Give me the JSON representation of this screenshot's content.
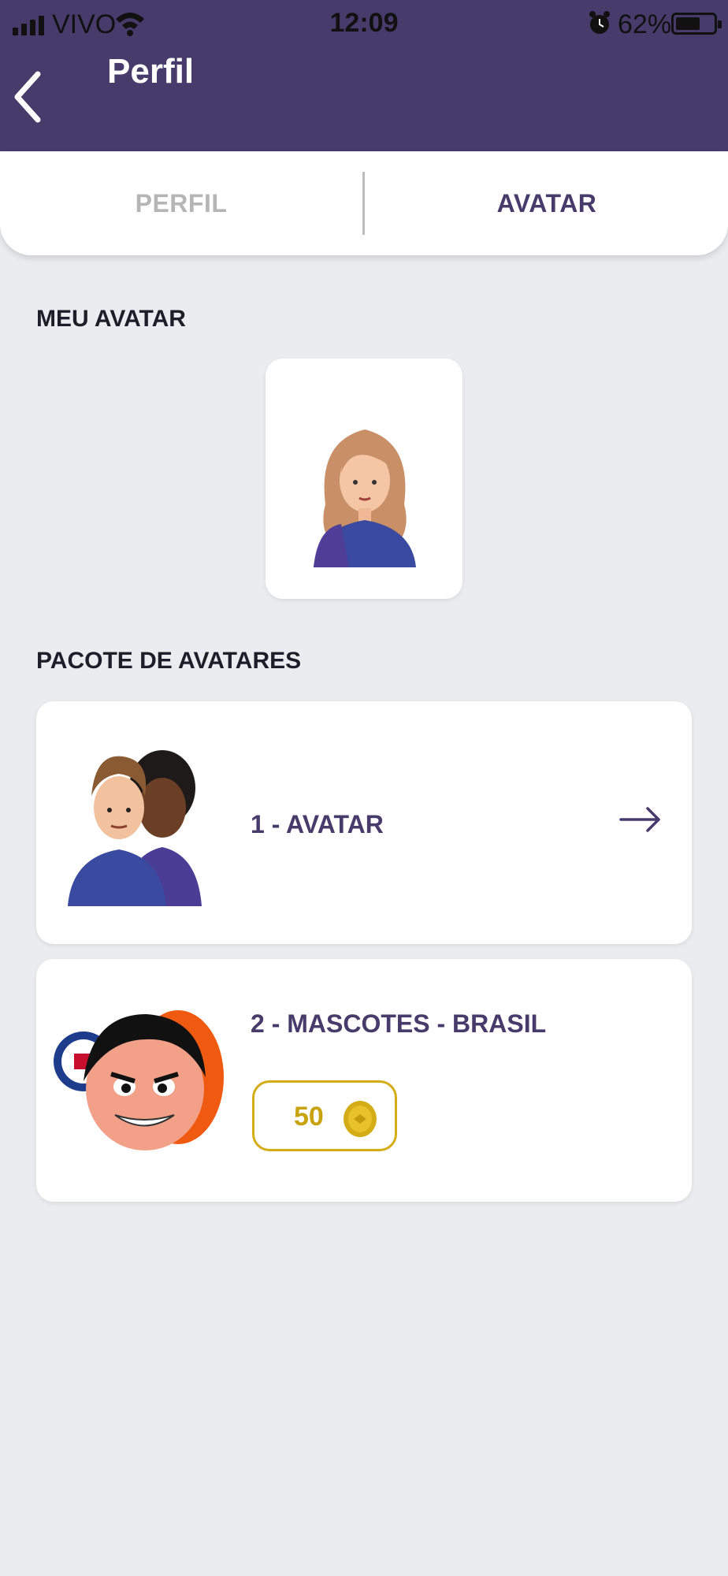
{
  "status_bar": {
    "carrier": "VIVO",
    "time": "12:09",
    "battery": "62%"
  },
  "header": {
    "title": "Perfil"
  },
  "tabs": [
    {
      "label": "PERFIL",
      "active": false
    },
    {
      "label": "AVATAR",
      "active": true
    }
  ],
  "my_avatar": {
    "section_title": "MEU AVATAR"
  },
  "packs": {
    "section_title": "PACOTE DE AVATARES",
    "items": [
      {
        "label": "1 - AVATAR"
      },
      {
        "label": "2 - MASCOTES - BRASIL",
        "price": "50"
      }
    ]
  },
  "colors": {
    "header": "#463b6b",
    "accent_text": "#463b6b",
    "background": "#ebecf0",
    "coin": "#d4ad16"
  }
}
